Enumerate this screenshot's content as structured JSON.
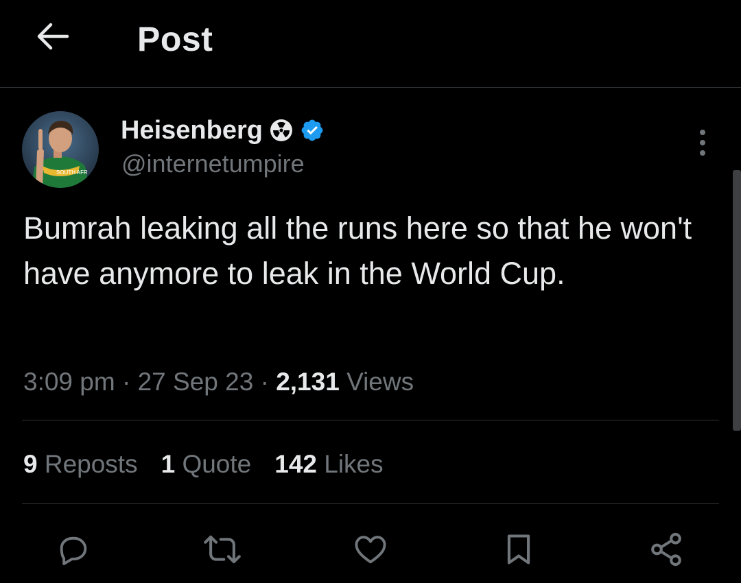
{
  "header": {
    "title": "Post",
    "back_icon": "arrow-left-icon"
  },
  "author": {
    "display_name": "Heisenberg",
    "emoji_icon": "radioactive-icon",
    "verified_icon": "verified-badge-icon",
    "handle": "@internetumpire",
    "avatar_shirt_text": "SOUTH AFR"
  },
  "tweet": {
    "text": "Bumrah leaking all the runs here so that he won't have anymore to leak in the World Cup."
  },
  "meta": {
    "time": "3:09 pm",
    "separator": " · ",
    "date": "27 Sep 23",
    "views_count": "2,131",
    "views_label": " Views"
  },
  "stats": {
    "reposts_count": "9",
    "reposts_label": " Reposts",
    "quotes_count": "1",
    "quotes_label": " Quote",
    "likes_count": "142",
    "likes_label": " Likes"
  },
  "actions": [
    "reply-icon",
    "repost-icon",
    "like-icon",
    "bookmark-icon",
    "share-icon"
  ],
  "colors": {
    "background": "#000000",
    "text": "#e7e9ea",
    "secondary": "#71767b",
    "divider": "#2f3336",
    "verified": "#1d9bf0"
  }
}
